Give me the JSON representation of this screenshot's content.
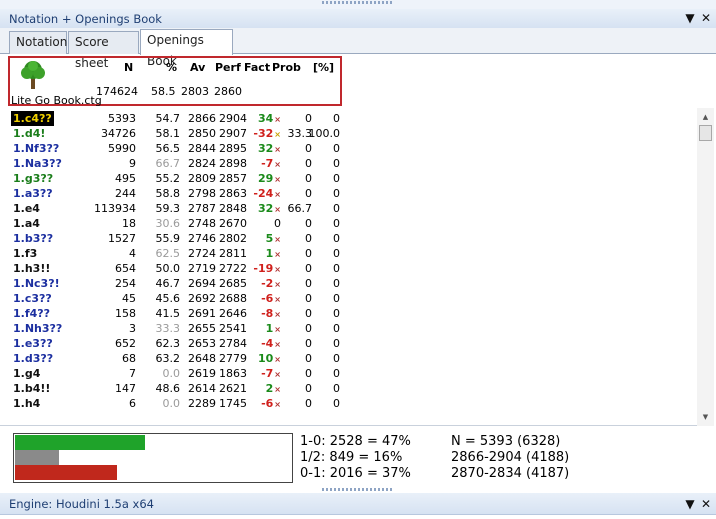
{
  "panel": {
    "title": "Notation + Openings Book",
    "pin": "▼",
    "close": "✕"
  },
  "tabs": [
    "Notation",
    "Score sheet",
    "Openings Book"
  ],
  "book_header": {
    "cols": [
      "N",
      "%",
      "Av",
      "Perf",
      "Fact",
      "Prob",
      "[%]"
    ],
    "values": [
      "174624",
      "58.5",
      "2803",
      "2860"
    ],
    "book_name": "Lite Go Book.ctg"
  },
  "moves": [
    {
      "move": "1.c4??",
      "n": "5393",
      "pct": "54.7",
      "av": "2866",
      "perf": "2904",
      "fact": "34",
      "prob": "0",
      "pp": "0"
    },
    {
      "move": "1.d4!",
      "n": "34726",
      "pct": "58.1",
      "av": "2850",
      "perf": "2907",
      "fact": "-32",
      "prob": "33.3",
      "pp": "100.0"
    },
    {
      "move": "1.Nf3??",
      "n": "5990",
      "pct": "56.5",
      "av": "2844",
      "perf": "2895",
      "fact": "32",
      "prob": "0",
      "pp": "0"
    },
    {
      "move": "1.Na3??",
      "n": "9",
      "pct": "66.7",
      "av": "2824",
      "perf": "2898",
      "fact": "-7",
      "prob": "0",
      "pp": "0"
    },
    {
      "move": "1.g3??",
      "n": "495",
      "pct": "55.2",
      "av": "2809",
      "perf": "2857",
      "fact": "29",
      "prob": "0",
      "pp": "0"
    },
    {
      "move": "1.a3??",
      "n": "244",
      "pct": "58.8",
      "av": "2798",
      "perf": "2863",
      "fact": "-24",
      "prob": "0",
      "pp": "0"
    },
    {
      "move": "1.e4",
      "n": "113934",
      "pct": "59.3",
      "av": "2787",
      "perf": "2848",
      "fact": "32",
      "prob": "66.7",
      "pp": "0"
    },
    {
      "move": "1.a4",
      "n": "18",
      "pct": "30.6",
      "av": "2748",
      "perf": "2670",
      "fact": "0",
      "prob": "0",
      "pp": "0"
    },
    {
      "move": "1.b3??",
      "n": "1527",
      "pct": "55.9",
      "av": "2746",
      "perf": "2802",
      "fact": "5",
      "prob": "0",
      "pp": "0"
    },
    {
      "move": "1.f3",
      "n": "4",
      "pct": "62.5",
      "av": "2724",
      "perf": "2811",
      "fact": "1",
      "prob": "0",
      "pp": "0"
    },
    {
      "move": "1.h3!!",
      "n": "654",
      "pct": "50.0",
      "av": "2719",
      "perf": "2722",
      "fact": "-19",
      "prob": "0",
      "pp": "0"
    },
    {
      "move": "1.Nc3?!",
      "n": "254",
      "pct": "46.7",
      "av": "2694",
      "perf": "2685",
      "fact": "-2",
      "prob": "0",
      "pp": "0"
    },
    {
      "move": "1.c3??",
      "n": "45",
      "pct": "45.6",
      "av": "2692",
      "perf": "2688",
      "fact": "-6",
      "prob": "0",
      "pp": "0"
    },
    {
      "move": "1.f4??",
      "n": "158",
      "pct": "41.5",
      "av": "2691",
      "perf": "2646",
      "fact": "-8",
      "prob": "0",
      "pp": "0"
    },
    {
      "move": "1.Nh3??",
      "n": "3",
      "pct": "33.3",
      "av": "2655",
      "perf": "2541",
      "fact": "1",
      "prob": "0",
      "pp": "0"
    },
    {
      "move": "1.e3??",
      "n": "652",
      "pct": "62.3",
      "av": "2653",
      "perf": "2784",
      "fact": "-4",
      "prob": "0",
      "pp": "0"
    },
    {
      "move": "1.d3??",
      "n": "68",
      "pct": "63.2",
      "av": "2648",
      "perf": "2779",
      "fact": "10",
      "prob": "0",
      "pp": "0"
    },
    {
      "move": "1.g4",
      "n": "7",
      "pct": "0.0",
      "av": "2619",
      "perf": "1863",
      "fact": "-7",
      "prob": "0",
      "pp": "0"
    },
    {
      "move": "1.b4!!",
      "n": "147",
      "pct": "48.6",
      "av": "2614",
      "perf": "2621",
      "fact": "2",
      "prob": "0",
      "pp": "0"
    },
    {
      "move": "1.h4",
      "n": "6",
      "pct": "0.0",
      "av": "2289",
      "perf": "1745",
      "fact": "-6",
      "prob": "0",
      "pp": "0"
    }
  ],
  "results": {
    "white_fraction": 0.47,
    "draw_fraction": 0.16,
    "black_fraction": 0.37,
    "white_color": "#1fa32a",
    "draw_color": "#8a8a8a",
    "black_color": "#c0281c",
    "line1": "1-0: 2528 = 47%",
    "line2": "1/2: 849 = 16%",
    "line3": "0-1: 2016 = 37%",
    "stat1": "N = 5393 (6328)",
    "stat2": "2866-2904 (4188)",
    "stat3": "2870-2834 (4187)"
  },
  "engine_panel": {
    "title": "Engine: Houdini 1.5a x64",
    "pin": "▼",
    "close": "✕"
  }
}
